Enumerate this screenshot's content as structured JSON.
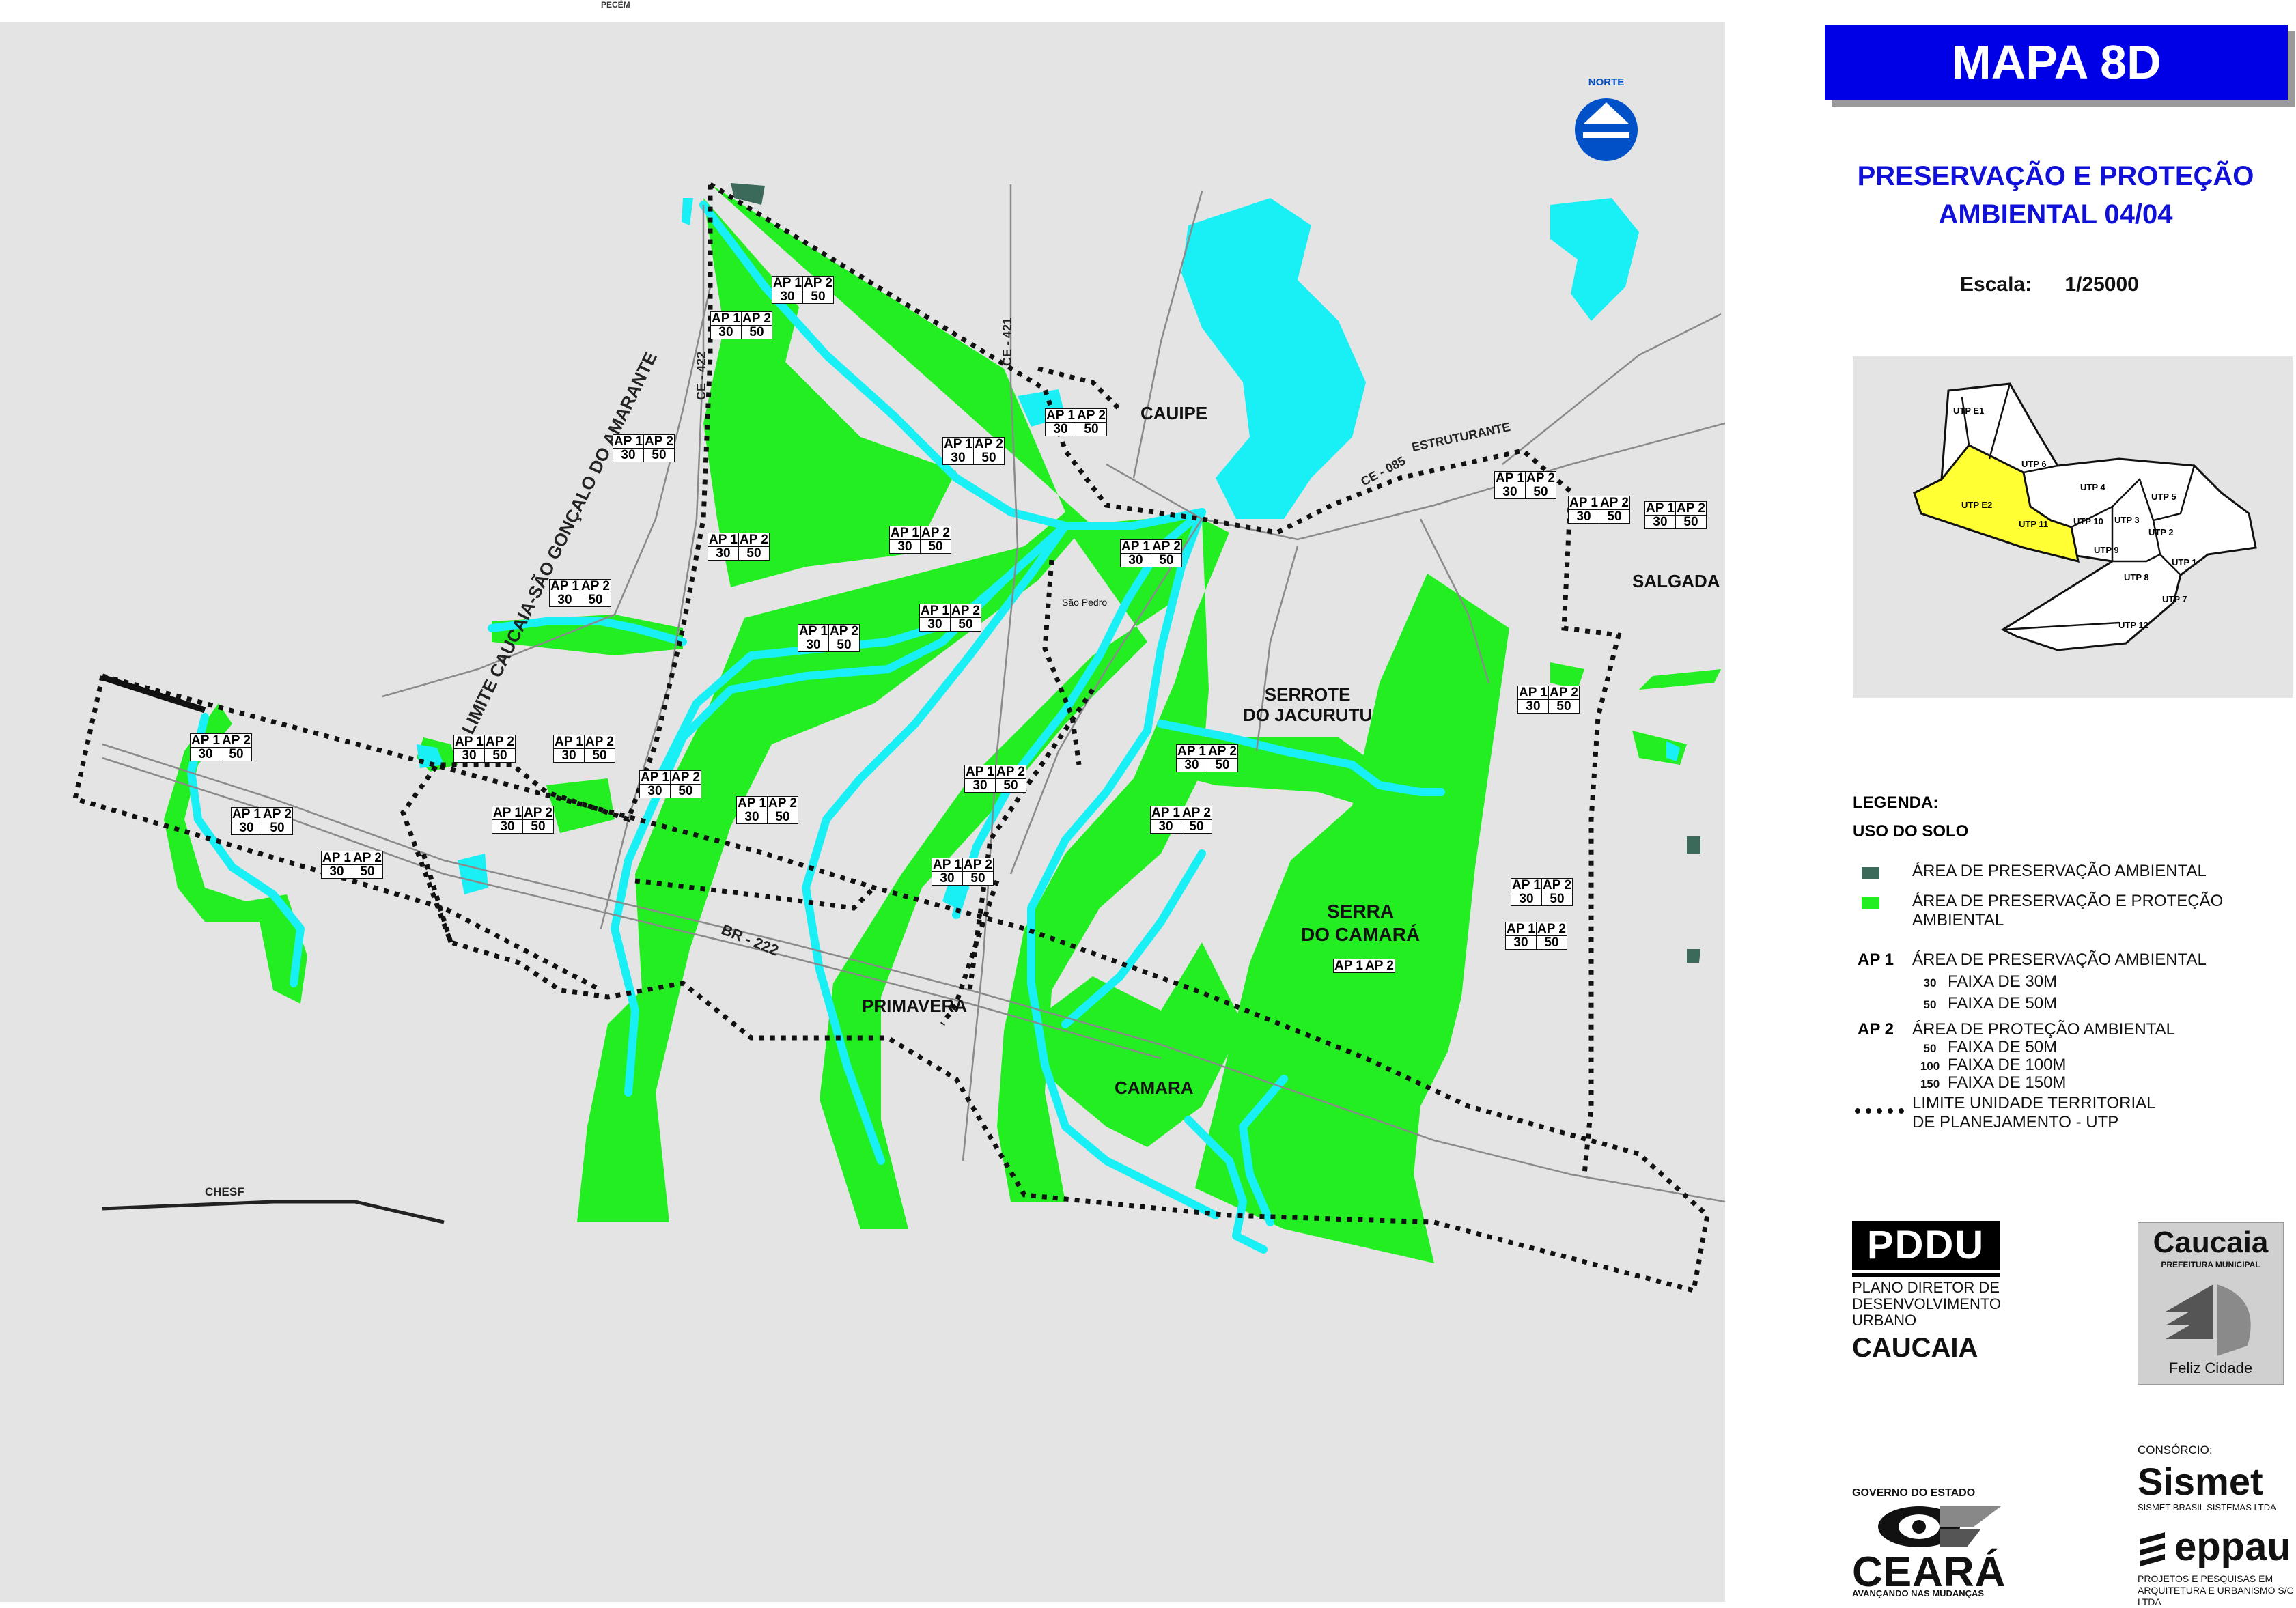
{
  "map": {
    "top_label": "PECÉM",
    "north_label": "NORTE",
    "places": {
      "cauipe": "CAUIPE",
      "salgada": "SALGADA",
      "serrote": "SERROTE\nDO JACURUTU",
      "serra": "SERRA\nDO CAMARÁ",
      "primavera": "PRIMAVERA",
      "camara": "CAMARA",
      "sao_pedro": "São Pedro"
    },
    "roads": {
      "ce422": "CE - 422",
      "ce421": "CE - 421",
      "ce085": "CE - 085",
      "estruturante": "ESTRUTURANTE",
      "br222": "BR - 222",
      "chesf": "CHESF",
      "limite": "LIMITE CAUCAIA-SÃO GONÇALO DO AMARANTE"
    },
    "ap_labels": {
      "ap1": "AP 1",
      "ap2": "AP 2",
      "v30": "30",
      "v50": "50"
    }
  },
  "header": {
    "title": "MAPA 8D",
    "subtitle_line1": "PRESERVAÇÃO E PROTEÇÃO",
    "subtitle_line2": "AMBIENTAL 04/04",
    "scale_label": "Escala:",
    "scale_value": "1/25000"
  },
  "inset": {
    "utps": [
      "UTP E1",
      "UTP 6",
      "UTP 4",
      "UTP 5",
      "UTP E2",
      "UTP 11",
      "UTP 10",
      "UTP 3",
      "UTP 2",
      "UTP 9",
      "UTP 1",
      "UTP 8",
      "UTP 7",
      "UTP 12"
    ],
    "highlight_color": "#ffff33"
  },
  "legend": {
    "title": "LEGENDA:",
    "subtitle": "USO DO SOLO",
    "item1": "ÁREA DE PRESERVAÇÃO AMBIENTAL",
    "item2": "ÁREA DE PRESERVAÇÃO E PROTEÇÃO\nAMBIENTAL",
    "ap1_code": "AP 1",
    "ap1_text": "ÁREA DE PRESERVAÇÃO AMBIENTAL",
    "ap1_faixas": [
      {
        "code": "30",
        "text": "FAIXA DE 30M"
      },
      {
        "code": "50",
        "text": "FAIXA DE 50M"
      }
    ],
    "ap2_code": "AP 2",
    "ap2_text": "ÁREA DE PROTEÇÃO AMBIENTAL",
    "ap2_faixas": [
      {
        "code": "50",
        "text": "FAIXA DE 50M"
      },
      {
        "code": "100",
        "text": "FAIXA DE 100M"
      },
      {
        "code": "150",
        "text": "FAIXA DE 150M"
      }
    ],
    "utp_text": "LIMITE UNIDADE TERRITORIAL\nDE PLANEJAMENTO - UTP",
    "colors": {
      "preservation": "#3c6a5a",
      "protection": "#22ee22",
      "water": "#19f0f5"
    }
  },
  "logos": {
    "pddu": "PDDU",
    "pddu_text": "PLANO DIRETOR DE\nDESENVOLVIMENTO\nURBANO",
    "pddu_city": "CAUCAIA",
    "pref_name": "Caucaia",
    "pref_sub": "PREFEITURA MUNICIPAL",
    "pref_slogan": "Feliz Cidade",
    "gov_title": "GOVERNO DO ESTADO",
    "ceara": "CEARÁ",
    "ceara_sub": "AVANÇANDO NAS MUDANÇAS",
    "consorcio": "CONSÓRCIO:",
    "sismet": "Sismet",
    "sismet_sub": "SISMET BRASIL SISTEMAS LTDA",
    "eppau": "eppau",
    "eppau_sub": "PROJETOS E PESQUISAS EM\nARQUITETURA E URBANISMO S/C LTDA"
  }
}
